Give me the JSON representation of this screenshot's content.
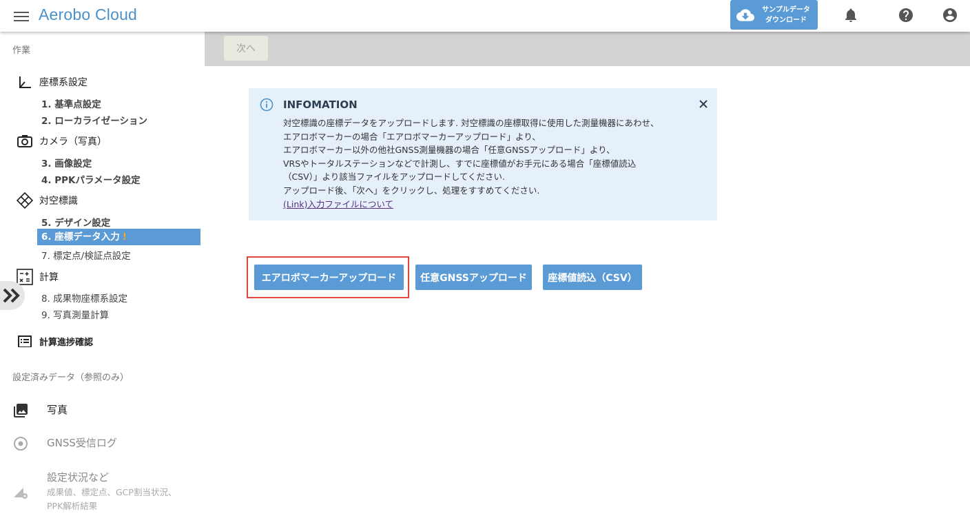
{
  "header": {
    "brand": "Aerobo Cloud",
    "sample_download_line1": "サンプルデータ",
    "sample_download_line2": "ダウンロード"
  },
  "sidebar": {
    "section_work": "作業",
    "groups": [
      {
        "label": "座標系設定",
        "icon": "axis-icon"
      },
      {
        "label": "カメラ（写真）",
        "icon": "camera-icon"
      },
      {
        "label": "対空標識",
        "icon": "target-marker-icon"
      },
      {
        "label": "計算",
        "icon": "calculator-icon"
      },
      {
        "label": "計算進捗確認",
        "icon": "list-icon"
      }
    ],
    "items": [
      "1. 基準点設定",
      "2. ローカライゼーション",
      "3. 画像設定",
      "4. PPKパラメータ設定",
      "5. デザイン設定",
      "6. 座標データ入力",
      "7. 標定点/検証点設定",
      "8. 成果物座標系設定",
      "9. 写真測量計算"
    ],
    "active_warning": "!",
    "section_reference": "設定済みデータ（参照のみ）",
    "reference": [
      {
        "label": "写真",
        "icon": "photo-icon"
      },
      {
        "label": "GNSS受信ログ",
        "icon": "gnss-icon"
      },
      {
        "label": "設定状況など",
        "sub1": "成果値、標定点、GCP割当状況、",
        "sub2": "PPK解析結果",
        "icon": "settings-status-icon"
      }
    ]
  },
  "toolbar": {
    "next_label": "次へ"
  },
  "info": {
    "title": "INFOMATION",
    "lines": [
      "対空標識の座標データをアップロードします. 対空標識の座標取得に使用した測量機器にあわせ、",
      "エアロボマーカーの場合「エアロボマーカーアップロード」より、",
      "エアロボマーカー以外の他社GNSS測量機器の場合「任意GNSSアップロード」より、",
      "VRSやトータルステーションなどで計測し、すでに座標値がお手元にある場合「座標値読込",
      "（CSV）」より該当ファイルをアップロードしてください.",
      "アップロード後、「次へ」をクリックし、処理をすすめてください."
    ],
    "link": "(Link)入力ファイルについて"
  },
  "actions": {
    "aerobo_upload": "エアロボマーカーアップロード",
    "gnss_upload": "任意GNSSアップロード",
    "csv_import": "座標値読込（CSV）"
  },
  "colors": {
    "accent": "#5b9bd5",
    "brand": "#4a90c9",
    "highlight": "#e0463a",
    "info_bg": "#e5f0fb",
    "warning": "#f5a623"
  }
}
